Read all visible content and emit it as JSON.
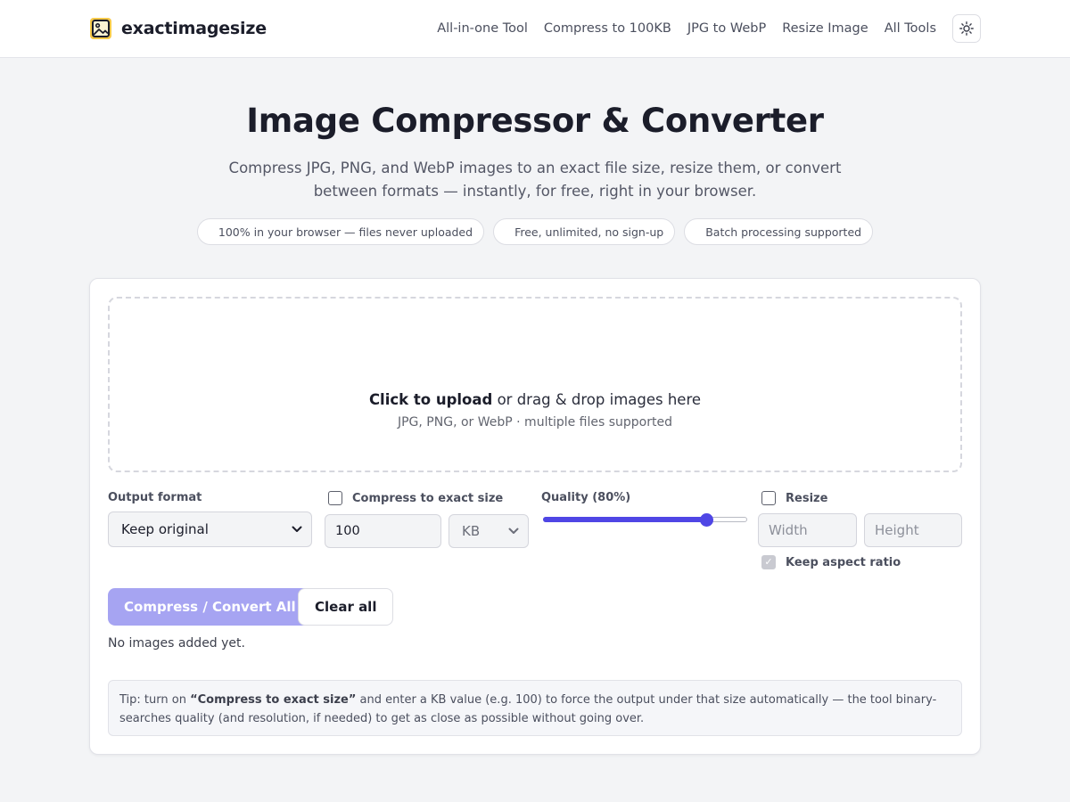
{
  "header": {
    "brand": "exactimagesize",
    "nav": [
      {
        "label": "All-in-one Tool"
      },
      {
        "label": "Compress to 100KB"
      },
      {
        "label": "JPG to WebP"
      },
      {
        "label": "Resize Image"
      },
      {
        "label": "All Tools"
      }
    ]
  },
  "hero": {
    "title": "Image Compressor & Converter",
    "subtitle": "Compress JPG, PNG, and WebP images to an exact file size, resize them, or convert between formats — instantly, for free, right in your browser.",
    "pills": [
      {
        "label": "100% in your browser — files never uploaded"
      },
      {
        "label": "Free, unlimited, no sign-up"
      },
      {
        "label": "Batch processing supported"
      }
    ]
  },
  "dropzone": {
    "primary_strong": "Click to upload",
    "primary_rest": " or drag & drop images here",
    "secondary": "JPG, PNG, or WebP · multiple files supported"
  },
  "controls": {
    "output_format": {
      "label": "Output format",
      "value": "Keep original"
    },
    "exact_size": {
      "label": "Compress to exact size",
      "checked": false,
      "value": "100",
      "unit": "KB"
    },
    "quality": {
      "label": "Quality (80%)",
      "value": 80
    },
    "resize": {
      "label": "Resize",
      "checked": false,
      "width_placeholder": "Width",
      "height_placeholder": "Height"
    },
    "aspect": {
      "label": "Keep aspect ratio",
      "checked": true
    }
  },
  "actions": {
    "primary": "Compress / Convert All",
    "secondary": "Clear all",
    "status": "No images added yet."
  },
  "tip": {
    "prefix": "Tip: turn on ",
    "strong": "“Compress to exact size”",
    "suffix": " and enter a KB value (e.g. 100) to force the output under that size automatically — the tool binary-searches quality (and resolution, if needed) to get as close as possible without going over."
  },
  "colors": {
    "accent": "#4f46e5",
    "accent_disabled": "#a6a4f2",
    "page_background": "#f3f4f6"
  },
  "icons": {
    "brand": "image-icon",
    "theme_toggle": "sun-icon",
    "select_caret": "chevron-down-icon",
    "checkmark": "checkmark-icon"
  }
}
